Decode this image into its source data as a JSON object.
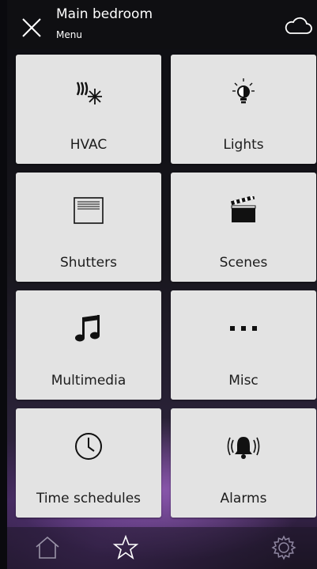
{
  "header": {
    "title": "Main bedroom",
    "subtitle": "Menu"
  },
  "tiles": [
    {
      "label": "HVAC",
      "icon": "hvac-icon"
    },
    {
      "label": "Lights",
      "icon": "lightbulb-icon"
    },
    {
      "label": "Shutters",
      "icon": "shutters-icon"
    },
    {
      "label": "Scenes",
      "icon": "clapperboard-icon"
    },
    {
      "label": "Multimedia",
      "icon": "music-note-icon"
    },
    {
      "label": "Misc",
      "icon": "more-dots-icon"
    },
    {
      "label": "Time schedules",
      "icon": "clock-icon"
    },
    {
      "label": "Alarms",
      "icon": "alarm-bell-icon"
    }
  ],
  "bottom_nav": [
    "home-icon",
    "star-icon",
    "settings-gear-icon"
  ],
  "colors": {
    "tile": "#e3e3e3",
    "header": "#0f0f12",
    "accent": "#b47ae6"
  }
}
